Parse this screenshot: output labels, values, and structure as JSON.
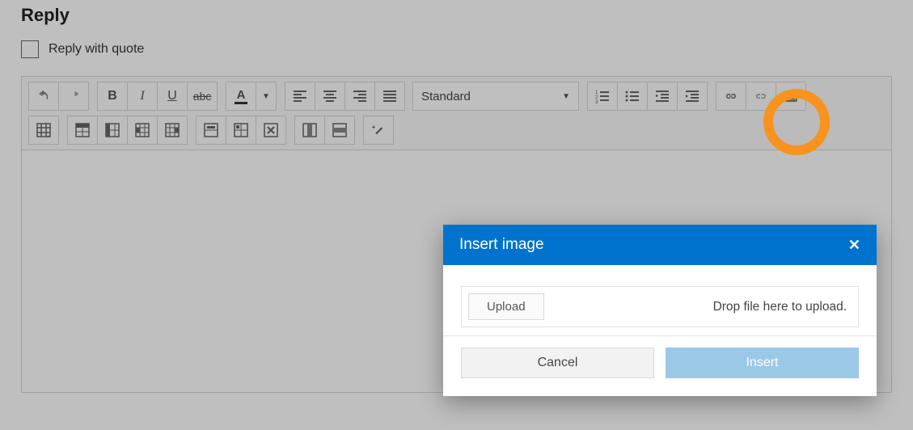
{
  "heading": "Reply",
  "quote_checkbox_label": "Reply with quote",
  "toolbar": {
    "format_dropdown_label": "Standard"
  },
  "modal": {
    "title": "Insert image",
    "upload_button": "Upload",
    "drop_text": "Drop file here to upload.",
    "cancel": "Cancel",
    "insert": "Insert"
  }
}
